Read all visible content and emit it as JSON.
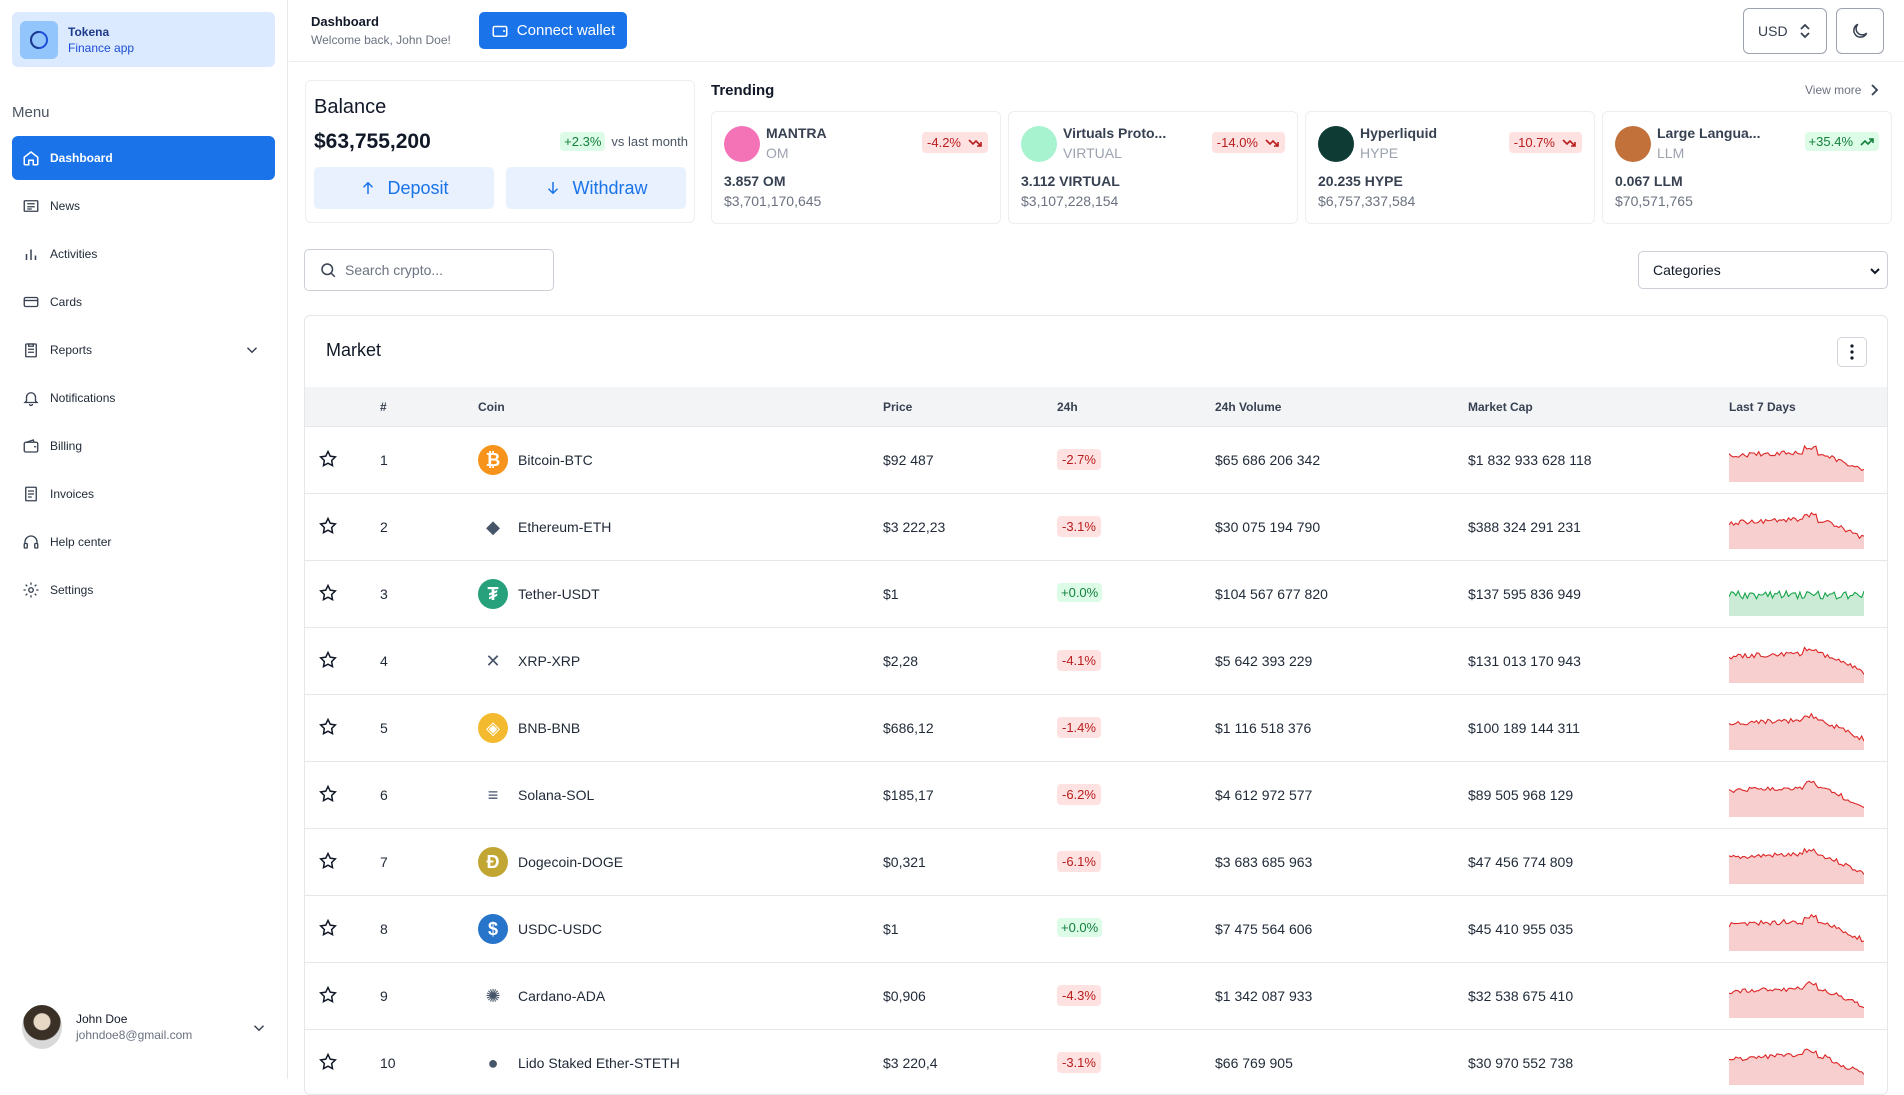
{
  "brand": {
    "name": "Tokena",
    "subtitle": "Finance app"
  },
  "menu": {
    "title": "Menu",
    "items": [
      {
        "label": "Dashboard",
        "icon": "home-icon",
        "active": true
      },
      {
        "label": "News",
        "icon": "newspaper-icon"
      },
      {
        "label": "Activities",
        "icon": "bar-chart-icon"
      },
      {
        "label": "Cards",
        "icon": "card-icon"
      },
      {
        "label": "Reports",
        "icon": "clipboard-icon",
        "expandable": true
      },
      {
        "label": "Notifications",
        "icon": "bell-icon"
      },
      {
        "label": "Billing",
        "icon": "wallet-icon"
      },
      {
        "label": "Invoices",
        "icon": "receipt-icon"
      },
      {
        "label": "Help center",
        "icon": "headset-icon"
      },
      {
        "label": "Settings",
        "icon": "gear-icon"
      }
    ]
  },
  "user": {
    "name": "John Doe",
    "email": "johndoe8@gmail.com"
  },
  "header": {
    "title": "Dashboard",
    "welcome": "Welcome back, John Doe!",
    "connect_label": "Connect wallet",
    "currency": "USD"
  },
  "balance": {
    "title": "Balance",
    "value": "$63,755,200",
    "change": "+2.3%",
    "change_suffix": "vs last month",
    "deposit_label": "Deposit",
    "withdraw_label": "Withdraw"
  },
  "trending": {
    "title": "Trending",
    "view_more": "View more",
    "items": [
      {
        "name": "MANTRA",
        "symbol": "OM",
        "change": "-4.2%",
        "direction": "down",
        "price": "3.857 OM",
        "cap": "$3,701,170,645",
        "color": "#f472b6"
      },
      {
        "name": "Virtuals Proto...",
        "symbol": "VIRTUAL",
        "change": "-14.0%",
        "direction": "down",
        "price": "3.112 VIRTUAL",
        "cap": "$3,107,228,154",
        "color": "#a7f3d0"
      },
      {
        "name": "Hyperliquid",
        "symbol": "HYPE",
        "change": "-10.7%",
        "direction": "down",
        "price": "20.235 HYPE",
        "cap": "$6,757,337,584",
        "color": "#0f3b35"
      },
      {
        "name": "Large Langua...",
        "symbol": "LLM",
        "change": "+35.4%",
        "direction": "up",
        "price": "0.067 LLM",
        "cap": "$70,571,765",
        "color": "#c2713b"
      }
    ]
  },
  "filters": {
    "search_placeholder": "Search crypto...",
    "categories_label": "Categories"
  },
  "market": {
    "title": "Market",
    "columns": [
      "#",
      "Coin",
      "Price",
      "24h",
      "24h Volume",
      "Market Cap",
      "Last 7 Days"
    ],
    "rows": [
      {
        "rank": "1",
        "coin": "Bitcoin-BTC",
        "price": "$92 487",
        "change": "-2.7%",
        "volume": "$65 686 206 342",
        "cap": "$1 832 933 628 118",
        "icon_color": "#f7931a",
        "glyph": "₿",
        "trend": "down"
      },
      {
        "rank": "2",
        "coin": "Ethereum-ETH",
        "price": "$3 222,23",
        "change": "-3.1%",
        "volume": "$30 075 194 790",
        "cap": "$388 324 291 231",
        "icon_color": "#ffffff",
        "glyph": "◆",
        "trend": "down"
      },
      {
        "rank": "3",
        "coin": "Tether-USDT",
        "price": "$1",
        "change": "+0.0%",
        "volume": "$104 567 677 820",
        "cap": "$137 595 836 949",
        "icon_color": "#26a17b",
        "glyph": "₮",
        "trend": "up"
      },
      {
        "rank": "4",
        "coin": "XRP-XRP",
        "price": "$2,28",
        "change": "-4.1%",
        "volume": "$5 642 393 229",
        "cap": "$131 013 170 943",
        "icon_color": "#ffffff",
        "glyph": "✕",
        "trend": "down"
      },
      {
        "rank": "5",
        "coin": "BNB-BNB",
        "price": "$686,12",
        "change": "-1.4%",
        "volume": "$1 116 518 376",
        "cap": "$100 189 144 311",
        "icon_color": "#f3ba2f",
        "glyph": "◈",
        "trend": "down"
      },
      {
        "rank": "6",
        "coin": "Solana-SOL",
        "price": "$185,17",
        "change": "-6.2%",
        "volume": "$4 612 972 577",
        "cap": "$89 505 968 129",
        "icon_color": "#ffffff",
        "glyph": "≡",
        "trend": "down"
      },
      {
        "rank": "7",
        "coin": "Dogecoin-DOGE",
        "price": "$0,321",
        "change": "-6.1%",
        "volume": "$3 683 685 963",
        "cap": "$47 456 774 809",
        "icon_color": "#c2a633",
        "glyph": "Ð",
        "trend": "down"
      },
      {
        "rank": "8",
        "coin": "USDC-USDC",
        "price": "$1",
        "change": "+0.0%",
        "volume": "$7 475 564 606",
        "cap": "$45 410 955 035",
        "icon_color": "#2775ca",
        "glyph": "$",
        "trend": "down"
      },
      {
        "rank": "9",
        "coin": "Cardano-ADA",
        "price": "$0,906",
        "change": "-4.3%",
        "volume": "$1 342 087 933",
        "cap": "$32 538 675 410",
        "icon_color": "#ffffff",
        "glyph": "✺",
        "trend": "down"
      },
      {
        "rank": "10",
        "coin": "Lido Staked Ether-STETH",
        "price": "$3 220,4",
        "change": "-3.1%",
        "volume": "$66 769 905",
        "cap": "$30 970 552 738",
        "icon_color": "#ffffff",
        "glyph": "●",
        "trend": "down"
      }
    ]
  },
  "colors": {
    "accent": "#1a73e8",
    "up": "#16a34a",
    "down": "#dc2626"
  }
}
